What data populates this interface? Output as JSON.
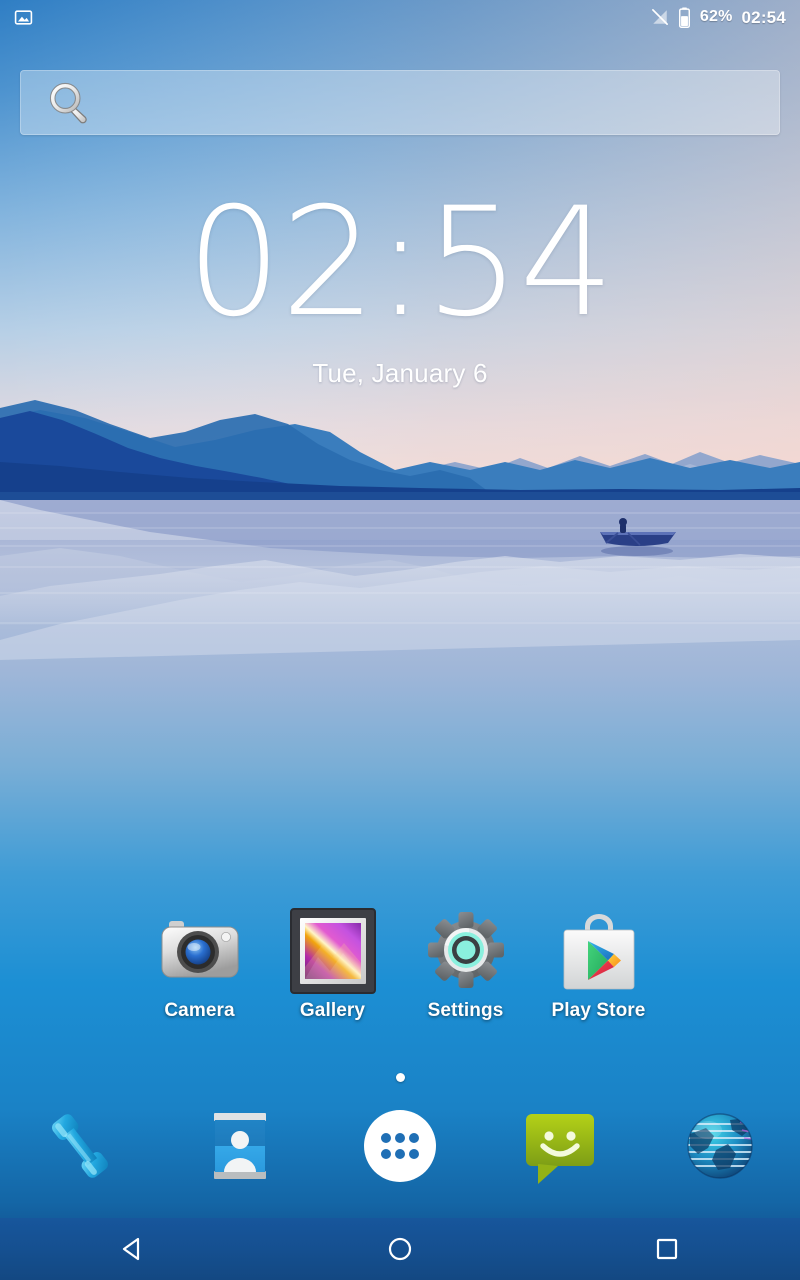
{
  "device": {
    "platform": "Android",
    "screen": "home-screen"
  },
  "status_bar": {
    "notification_icon": "image-icon",
    "signal_icon": "no-sim-signal-icon",
    "battery_icon": "battery-icon",
    "battery_percent": "62%",
    "clock": "02:54"
  },
  "search_widget": {
    "icon": "search-icon",
    "placeholder": "",
    "value": ""
  },
  "clock_widget": {
    "time": "02:54",
    "date": "Tue, January 6"
  },
  "app_grid": {
    "apps": [
      {
        "label": "Camera",
        "icon": "camera-icon"
      },
      {
        "label": "Gallery",
        "icon": "gallery-icon"
      },
      {
        "label": "Settings",
        "icon": "settings-gear-icon"
      },
      {
        "label": "Play Store",
        "icon": "play-store-icon"
      }
    ]
  },
  "page_indicator": {
    "pages": 1,
    "current": 1
  },
  "dock": {
    "items": [
      {
        "label": "Phone",
        "icon": "phone-handset-icon"
      },
      {
        "label": "Contacts",
        "icon": "contacts-card-icon"
      },
      {
        "label": "Apps",
        "icon": "app-drawer-icon"
      },
      {
        "label": "Messaging",
        "icon": "messaging-bubble-icon"
      },
      {
        "label": "Browser",
        "icon": "browser-globe-icon"
      }
    ]
  },
  "nav_bar": {
    "buttons": [
      {
        "label": "Back",
        "icon": "back-triangle-icon"
      },
      {
        "label": "Home",
        "icon": "home-circle-icon"
      },
      {
        "label": "Recents",
        "icon": "recents-square-icon"
      }
    ]
  },
  "wallpaper": {
    "description": "Stylized lake at dusk with layered blue mountains and a rowboat",
    "sky_top": "#3b84c9",
    "sky_horizon": "#f3dcd7",
    "mountain_dark": "#1b4e9b",
    "mountain_mid": "#2f72b5",
    "mountain_light": "#8fa5cd",
    "water_top": "#b9c3dd",
    "water_mid": "#1b8fd4",
    "water_bottom": "#0f3d75",
    "boat": "#2a3f87"
  },
  "colors": {
    "accent_blue": "#1b8fd4",
    "nav_bar_blue": "#15508f",
    "label_white": "#ffffff",
    "settings_teal": "#8ff0e0",
    "messaging_green": "#94b620"
  }
}
